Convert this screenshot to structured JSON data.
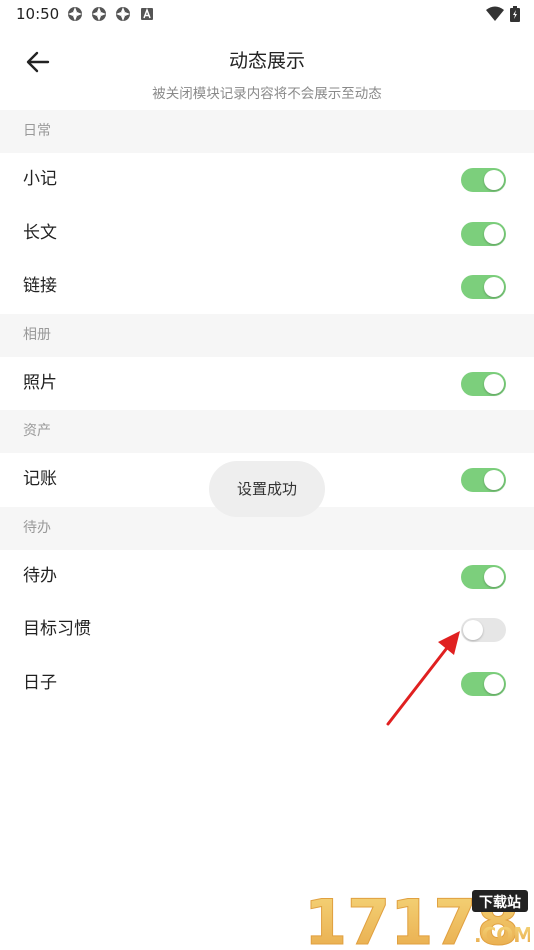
{
  "status_bar": {
    "time": "10:50",
    "notification_icons": [
      "app-notification-icon",
      "app-notification-icon",
      "app-notification-icon",
      "a-badge-icon"
    ],
    "system_icons": [
      "wifi-icon",
      "battery-charging-icon"
    ]
  },
  "header": {
    "title": "动态展示",
    "subtitle": "被关闭模块记录内容将不会展示至动态",
    "back_icon": "back-arrow-icon"
  },
  "sections": [
    {
      "title": "日常",
      "items": [
        {
          "label": "小记",
          "enabled": true
        },
        {
          "label": "长文",
          "enabled": true
        },
        {
          "label": "链接",
          "enabled": true
        }
      ]
    },
    {
      "title": "相册",
      "items": [
        {
          "label": "照片",
          "enabled": true
        }
      ]
    },
    {
      "title": "资产",
      "items": [
        {
          "label": "记账",
          "enabled": true
        }
      ]
    },
    {
      "title": "待办",
      "items": [
        {
          "label": "待办",
          "enabled": true
        },
        {
          "label": "目标习惯",
          "enabled": false
        },
        {
          "label": "日子",
          "enabled": true
        }
      ]
    }
  ],
  "toast": {
    "text": "设置成功"
  },
  "watermark": {
    "text": "17178",
    "badge": "下载站",
    "domain": ".COM"
  },
  "colors": {
    "toggle_on": "#7ccf7c",
    "toggle_off": "#e6e6e6",
    "section_bg": "#f6f6f6",
    "annotation_arrow": "#e02020"
  }
}
